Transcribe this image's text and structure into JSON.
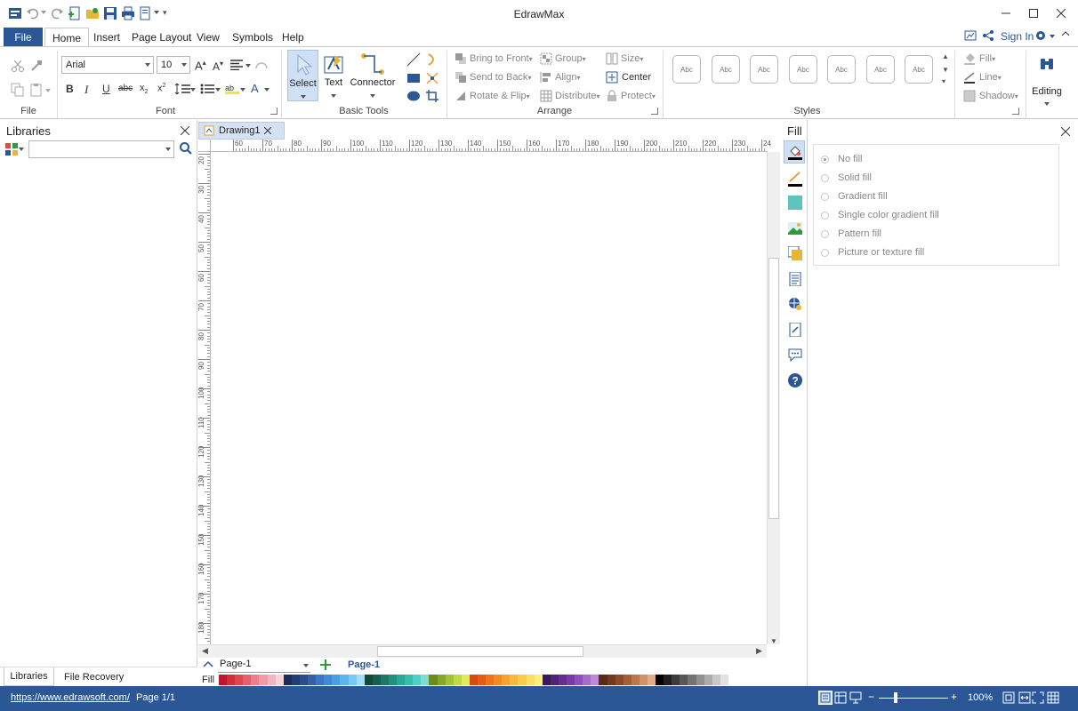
{
  "app": {
    "title": "EdrawMax"
  },
  "menu": {
    "file_label": "File",
    "tabs": [
      "Home",
      "Insert",
      "Page Layout",
      "View",
      "Symbols",
      "Help"
    ],
    "sign_in": "Sign In"
  },
  "ribbon": {
    "file_group_label": "File",
    "font": {
      "family": "Arial",
      "size": "10",
      "group_label": "Font"
    },
    "basic_tools": {
      "select": "Select",
      "text": "Text",
      "connector": "Connector",
      "group_label": "Basic Tools"
    },
    "arrange": {
      "bring_to_front": "Bring to Front",
      "send_to_back": "Send to Back",
      "rotate_flip": "Rotate & Flip",
      "group": "Group",
      "align": "Align",
      "distribute": "Distribute",
      "size": "Size",
      "center": "Center",
      "protect": "Protect",
      "group_label": "Arrange"
    },
    "styles": {
      "sample": "Abc",
      "group_label": "Styles"
    },
    "format": {
      "fill": "Fill",
      "line": "Line",
      "shadow": "Shadow"
    },
    "editing": "Editing"
  },
  "libraries": {
    "title": "Libraries",
    "search_placeholder": ""
  },
  "document": {
    "tab": "Drawing1"
  },
  "ruler": {
    "h_ticks": [
      "60",
      "70",
      "80",
      "90",
      "100",
      "110",
      "120",
      "130",
      "140",
      "150",
      "160",
      "170",
      "180",
      "190",
      "200",
      "210",
      "220",
      "230",
      "24"
    ],
    "v_ticks": [
      "20",
      "30",
      "40",
      "50",
      "60",
      "70",
      "80",
      "90",
      "100",
      "110",
      "120",
      "130",
      "140",
      "150",
      "160",
      "170",
      "180"
    ]
  },
  "fill_panel": {
    "title": "Fill",
    "options": [
      "No fill",
      "Solid fill",
      "Gradient fill",
      "Single color gradient fill",
      "Pattern fill",
      "Picture or texture fill"
    ],
    "selected": "No fill"
  },
  "pages": {
    "current": "Page-1",
    "tab": "Page-1"
  },
  "palette": {
    "label": "Fill"
  },
  "bottom_tabs": [
    "Libraries",
    "File Recovery"
  ],
  "status": {
    "url": "https://www.edrawsoft.com/",
    "page": "Page 1/1",
    "zoom": "100%"
  },
  "colors": {
    "accent": "#2b5797",
    "selection": "#cfe0f4"
  }
}
